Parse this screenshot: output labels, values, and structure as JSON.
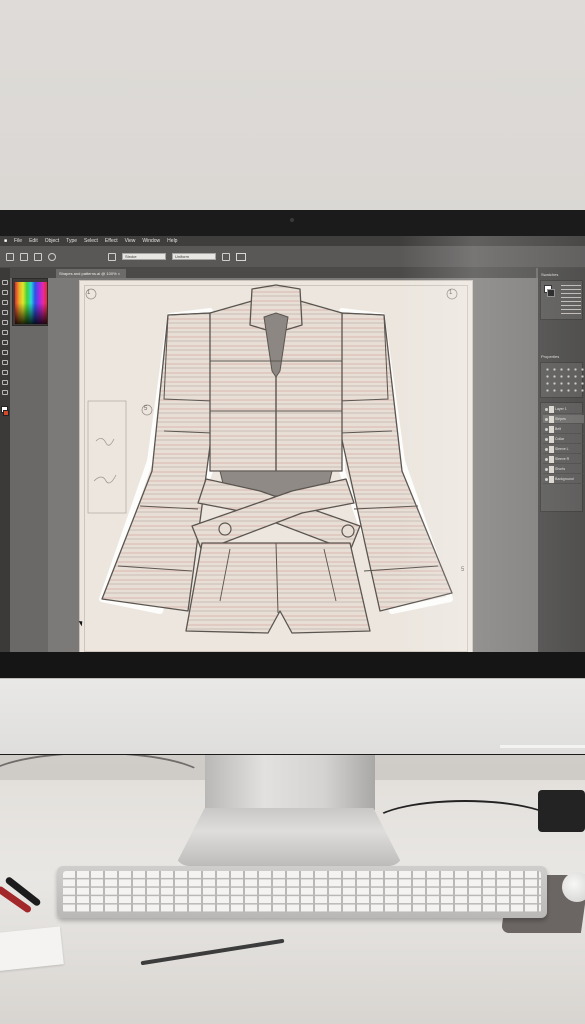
{
  "photo": {
    "subject": "fashion-design-workstation",
    "colors": {
      "wall": "#d9d6d2",
      "desk": "#e6e3df",
      "bezel": "#1b1b1c",
      "ui_dark": "#3f3e3d",
      "artboard": "#ece6df",
      "garment_stroke": "#5b5550",
      "garment_stripe_red": "#c9908c"
    }
  },
  "app": {
    "menu": [
      "File",
      "Edit",
      "Object",
      "Type",
      "Select",
      "Effect",
      "View",
      "Window",
      "Help"
    ],
    "options": {
      "field_1": "Stroke",
      "field_2": "Uniform"
    },
    "document_tab": "Shapes and patterns.ai @ 100% ×",
    "artboard_markers": [
      "1",
      "1",
      "5",
      "5"
    ],
    "panels": {
      "top": "Swatches",
      "middle": "Properties",
      "layers": [
        {
          "name": "Layer 1"
        },
        {
          "name": "Stripes"
        },
        {
          "name": "Belt"
        },
        {
          "name": "Collar"
        },
        {
          "name": "Sleeve L"
        },
        {
          "name": "Sleeve R"
        },
        {
          "name": "Shorts"
        },
        {
          "name": "Background"
        }
      ]
    },
    "icons": [
      "select-tool-icon",
      "direct-select-icon",
      "pen-tool-icon",
      "type-tool-icon",
      "brush-tool-icon",
      "zoom-tool-icon"
    ]
  }
}
